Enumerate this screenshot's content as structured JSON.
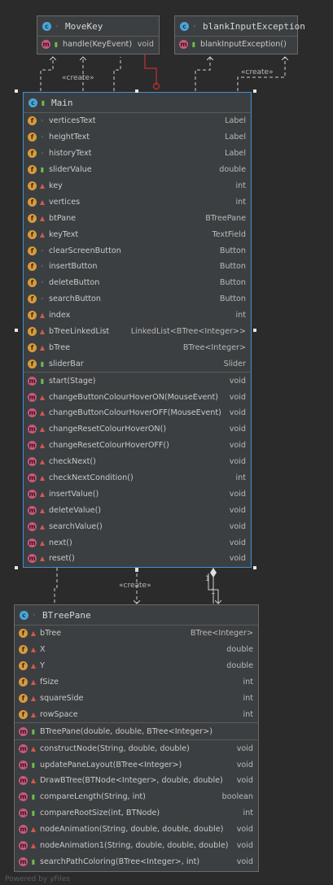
{
  "classes": {
    "movekey": {
      "title": "MoveKey",
      "methods": [
        {
          "name": "handle(KeyEvent)",
          "type": "void",
          "vis": "pub"
        }
      ]
    },
    "blank": {
      "title": "blankInputException",
      "methods": [
        {
          "name": "blankInputException()",
          "type": "",
          "vis": "pub"
        }
      ]
    },
    "main": {
      "title": "Main",
      "fields": [
        {
          "name": "verticesText",
          "type": "Label",
          "vis": "pkg"
        },
        {
          "name": "heightText",
          "type": "Label",
          "vis": "pkg"
        },
        {
          "name": "historyText",
          "type": "Label",
          "vis": "pkg"
        },
        {
          "name": "sliderValue",
          "type": "double",
          "vis": "pub"
        },
        {
          "name": "key",
          "type": "int",
          "vis": "priv"
        },
        {
          "name": "vertices",
          "type": "int",
          "vis": "priv"
        },
        {
          "name": "btPane",
          "type": "BTreePane",
          "vis": "priv"
        },
        {
          "name": "keyText",
          "type": "TextField",
          "vis": "priv"
        },
        {
          "name": "clearScreenButton",
          "type": "Button",
          "vis": "pkg"
        },
        {
          "name": "insertButton",
          "type": "Button",
          "vis": "pkg"
        },
        {
          "name": "deleteButton",
          "type": "Button",
          "vis": "pkg"
        },
        {
          "name": "searchButton",
          "type": "Button",
          "vis": "pkg"
        },
        {
          "name": "index",
          "type": "int",
          "vis": "priv"
        },
        {
          "name": "bTreeLinkedList",
          "type": "LinkedList<BTree<Integer>>",
          "vis": "priv"
        },
        {
          "name": "bTree",
          "type": "BTree<Integer>",
          "vis": "priv"
        },
        {
          "name": "sliderBar",
          "type": "Slider",
          "vis": "pub"
        }
      ],
      "methods": [
        {
          "name": "start(Stage)",
          "type": "void",
          "vis": "pub"
        },
        {
          "name": "changeButtonColourHoverON(MouseEvent)",
          "type": "void",
          "vis": "priv"
        },
        {
          "name": "changeButtonColourHoverOFF(MouseEvent)",
          "type": "void",
          "vis": "priv"
        },
        {
          "name": "changeResetColourHoverON()",
          "type": "void",
          "vis": "priv"
        },
        {
          "name": "changeResetColourHoverOFF()",
          "type": "void",
          "vis": "priv"
        },
        {
          "name": "checkNext()",
          "type": "void",
          "vis": "priv"
        },
        {
          "name": "checkNextCondition()",
          "type": "int",
          "vis": "priv"
        },
        {
          "name": "insertValue()",
          "type": "void",
          "vis": "priv"
        },
        {
          "name": "deleteValue()",
          "type": "void",
          "vis": "priv"
        },
        {
          "name": "searchValue()",
          "type": "void",
          "vis": "priv"
        },
        {
          "name": "next()",
          "type": "void",
          "vis": "priv"
        },
        {
          "name": "reset()",
          "type": "void",
          "vis": "priv"
        }
      ]
    },
    "btreepane": {
      "title": "BTreePane",
      "fields": [
        {
          "name": "bTree",
          "type": "BTree<Integer>",
          "vis": "priv"
        },
        {
          "name": "X",
          "type": "double",
          "vis": "priv"
        },
        {
          "name": "Y",
          "type": "double",
          "vis": "priv"
        },
        {
          "name": "fSize",
          "type": "int",
          "vis": "priv"
        },
        {
          "name": "squareSide",
          "type": "int",
          "vis": "priv"
        },
        {
          "name": "rowSpace",
          "type": "int",
          "vis": "priv"
        }
      ],
      "constructors": [
        {
          "name": "BTreePane(double, double, BTree<Integer>)",
          "type": "",
          "vis": "pub"
        }
      ],
      "methods": [
        {
          "name": "constructNode(String, double, double)",
          "type": "void",
          "vis": "priv"
        },
        {
          "name": "updatePaneLayout(BTree<Integer>)",
          "type": "void",
          "vis": "pub"
        },
        {
          "name": "DrawBTree(BTNode<Integer>, double, double)",
          "type": "void",
          "vis": "priv"
        },
        {
          "name": "compareLength(String, int)",
          "type": "boolean",
          "vis": "pub"
        },
        {
          "name": "compareRootSize(int, BTNode)",
          "type": "int",
          "vis": "pub"
        },
        {
          "name": "nodeAnimation(String, double, double, double)",
          "type": "void",
          "vis": "priv"
        },
        {
          "name": "nodeAnimation1(String, double, double, double)",
          "type": "void",
          "vis": "priv"
        },
        {
          "name": "searchPathColoring(BTree<Integer>, int)",
          "type": "void",
          "vis": "pub"
        }
      ]
    }
  },
  "labels": {
    "create1": "«create»",
    "create2": "«create»",
    "create3": "«create»",
    "mult1": "1",
    "mult2": "1"
  },
  "footer": "Powered by yFiles",
  "colors": {
    "background": "#2b2b2b",
    "node": "#3c3f41",
    "selection": "#3f8fd6",
    "field_icon": "#d79b3c",
    "method_icon": "#c75a7a",
    "class_icon": "#4aa6d9",
    "public": "#6fbf4a",
    "private": "#d05a4a",
    "implements_arrow": "#c53030"
  }
}
